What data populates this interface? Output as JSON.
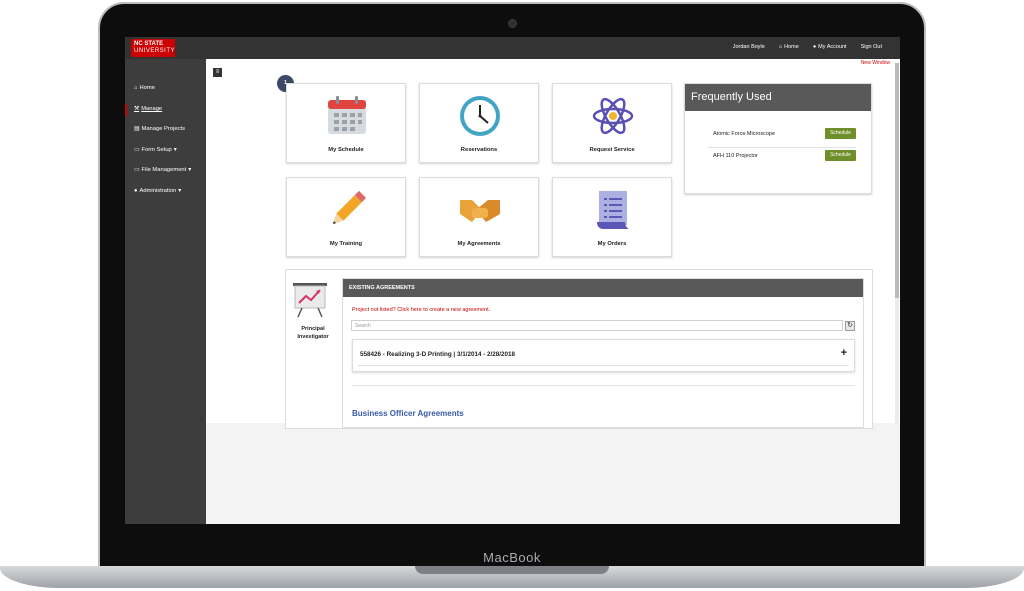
{
  "device": {
    "brand": "MacBook"
  },
  "header": {
    "logo_line1": "NC STATE",
    "logo_line2": "UNIVERSITY",
    "user": "Jordan Boyle",
    "home": "Home",
    "account": "My Account",
    "signout": "Sign Out",
    "new_window": "New Window"
  },
  "sidebar": {
    "items": [
      {
        "label": "Home"
      },
      {
        "label": "Manage"
      },
      {
        "label": "Manage Projects"
      },
      {
        "label": "Form Setup"
      },
      {
        "label": "File Management"
      },
      {
        "label": "Administration"
      }
    ]
  },
  "badge": "1",
  "tiles": [
    {
      "label": "My Schedule",
      "icon": "calendar-icon"
    },
    {
      "label": "Reservations",
      "icon": "clock-icon"
    },
    {
      "label": "Request Service",
      "icon": "atom-icon"
    },
    {
      "label": "My Training",
      "icon": "pencil-icon"
    },
    {
      "label": "My Agreements",
      "icon": "handshake-icon"
    },
    {
      "label": "My Orders",
      "icon": "document-icon"
    }
  ],
  "frequently_used": {
    "title": "Frequently Used",
    "items": [
      {
        "name": "Atomic Force Microscope",
        "button": "Schedule"
      },
      {
        "name": "AFH 110 Projector",
        "button": "Schedule"
      }
    ]
  },
  "agreements": {
    "role": "Principal Investigator",
    "header": "EXISTING AGREEMENTS",
    "link": "Project not listed? Click here to create a new agreement.",
    "search_placeholder": "Search",
    "item": "558426 - Realizing 3-D Printing | 3/1/2014 - 2/28/2018",
    "business_heading": "Business Officer Agreements"
  },
  "colors": {
    "brand_red": "#cc0000",
    "schedule_green": "#6f8f2a",
    "link_blue": "#3a59a8",
    "topbar": "#333333",
    "sidebar": "#3d3d3d"
  }
}
